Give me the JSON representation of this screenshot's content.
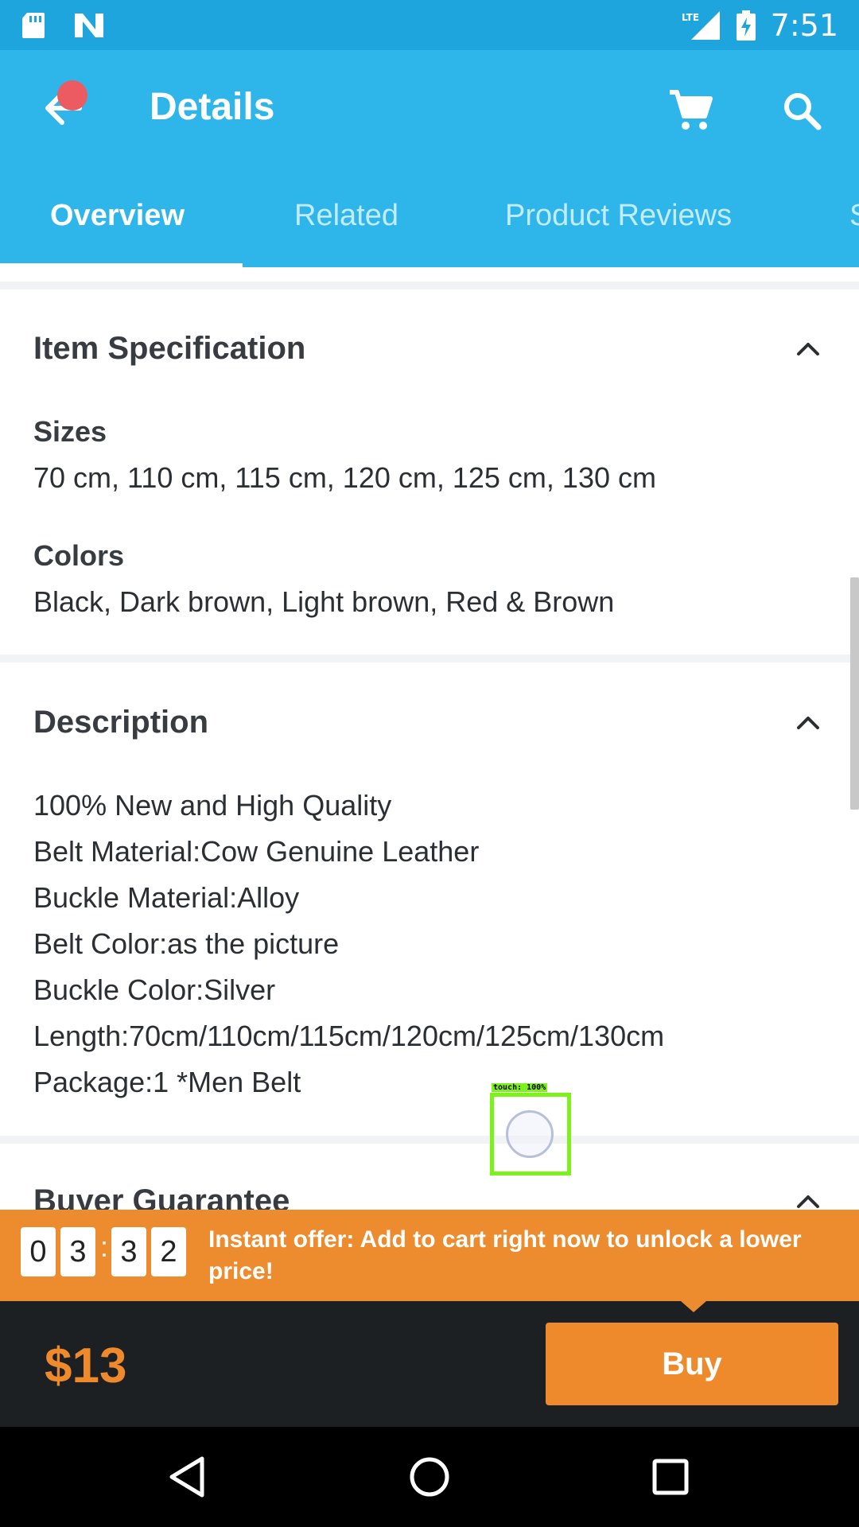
{
  "status_bar": {
    "time": "7:51",
    "network": "LTE",
    "icons": [
      "sd-card-icon",
      "n-notification-icon",
      "lte-signal-icon",
      "battery-charging-icon"
    ]
  },
  "app_bar": {
    "title": "Details",
    "icons": [
      "back-arrow-icon",
      "cart-icon",
      "search-icon"
    ]
  },
  "tabs": [
    {
      "label": "Overview",
      "active": true
    },
    {
      "label": "Related",
      "active": false
    },
    {
      "label": "Product Reviews",
      "active": false
    },
    {
      "label": "S",
      "active": false
    }
  ],
  "item_specification": {
    "title": "Item Specification",
    "sizes_label": "Sizes",
    "sizes_value": "70 cm, 110 cm, 115 cm, 120 cm, 125 cm, 130 cm",
    "colors_label": "Colors",
    "colors_value": "Black, Dark brown, Light brown, Red & Brown"
  },
  "description": {
    "title": "Description",
    "lines": [
      "100% New and High Quality",
      "Belt Material:Cow Genuine Leather",
      "Buckle Material:Alloy",
      "Belt Color:as the picture",
      "Buckle Color:Silver",
      "Length:70cm/110cm/115cm/120cm/125cm/130cm",
      "Package:1 *Men Belt"
    ]
  },
  "buyer_guarantee": {
    "title": "Buyer Guarantee"
  },
  "touch_indicator": {
    "label": "touch: 100%"
  },
  "offer": {
    "digits": [
      "0",
      "3",
      "3",
      "2"
    ],
    "separator": ":",
    "text": "Instant offer: Add to cart right now to unlock a lower price!"
  },
  "bottom_bar": {
    "price": "$13",
    "buy_label": "Buy"
  },
  "colors": {
    "status_bar": "#1ea5dd",
    "app_bar": "#2eb6ea",
    "accent_orange": "#ed8c2e",
    "bottom_bar": "#1d2023",
    "notification_dot": "#ec5b62"
  }
}
